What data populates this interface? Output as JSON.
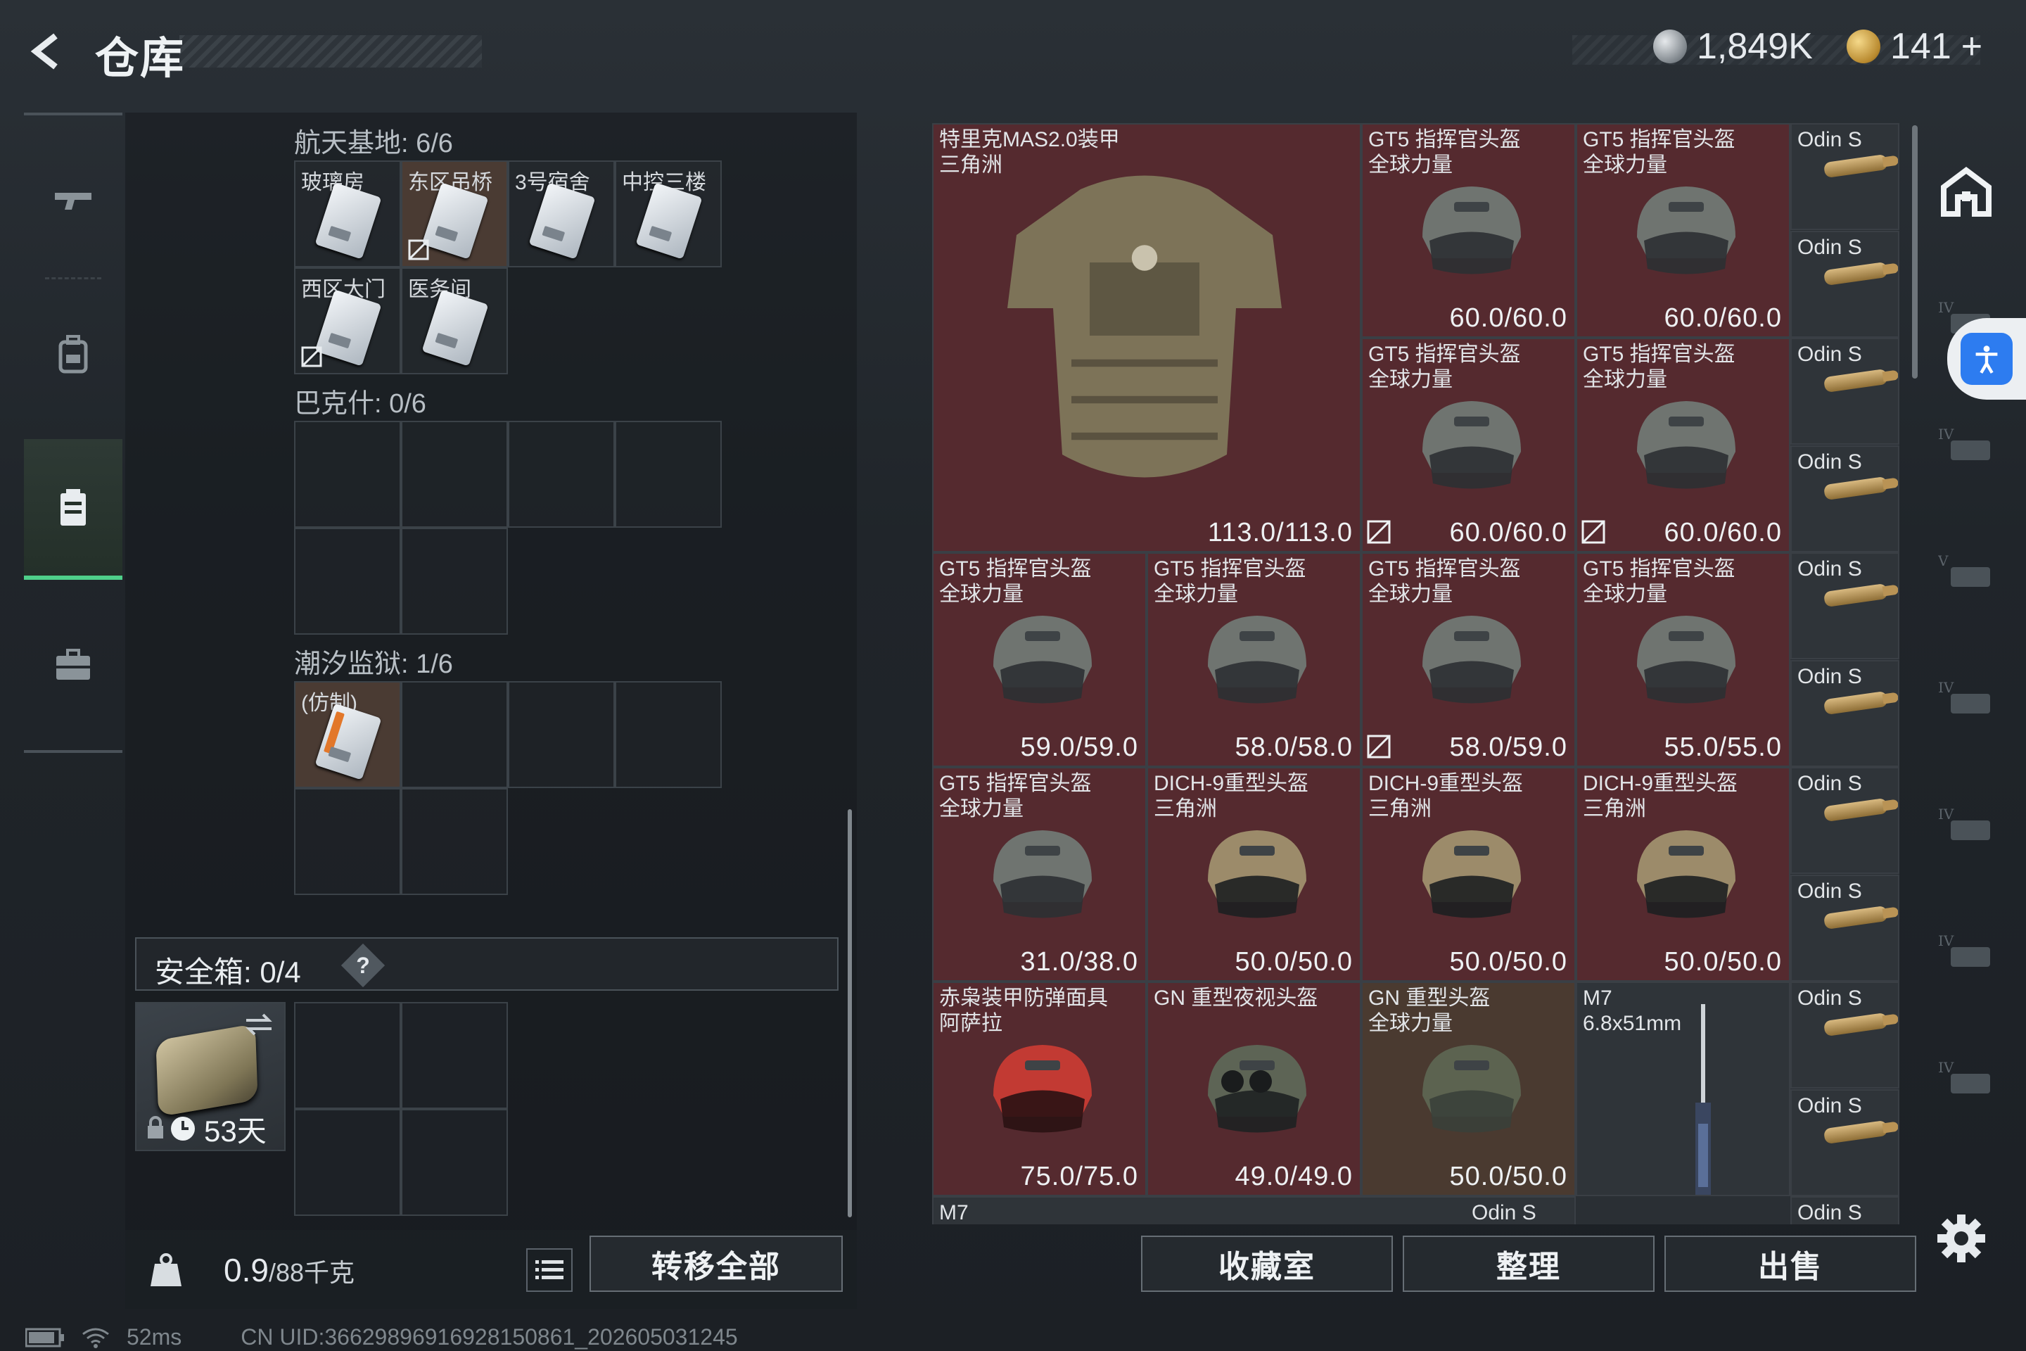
{
  "header": {
    "title": "仓库",
    "currency_silver": "1,849K",
    "currency_gold": "141",
    "plus": "+"
  },
  "containers": [
    {
      "label": "航天基地: 6/6",
      "keys": [
        "玻璃房",
        "东区吊桥",
        "3号宿舍",
        "中控三楼",
        "西区大门",
        "医务间"
      ]
    },
    {
      "label": "巴克什: 0/6",
      "keys": []
    },
    {
      "label": "潮汐监狱: 1/6",
      "keys": [
        "(仿制)"
      ]
    }
  ],
  "safebox": {
    "label": "安全箱:  0/4",
    "help": "?",
    "days": "53天"
  },
  "weight": {
    "current": "0.9",
    "max": "/88千克"
  },
  "buttons": {
    "transfer_all": "转移全部",
    "collection": "收藏室",
    "sort": "整理",
    "sell": "出售"
  },
  "stash_items": [
    {
      "name": "特里克MAS2.0装甲\n三角洲",
      "dur": "113.0/113.0",
      "kind": "armor"
    },
    {
      "name": "GT5 指挥官头盔\n全球力量",
      "dur": "60.0/60.0",
      "kind": "helmet"
    },
    {
      "name": "GT5 指挥官头盔\n全球力量",
      "dur": "60.0/60.0",
      "kind": "helmet"
    },
    {
      "name": "GT5 指挥官头盔\n全球力量",
      "dur": "60.0/60.0",
      "kind": "helmet"
    },
    {
      "name": "GT5 指挥官头盔\n全球力量",
      "dur": "60.0/60.0",
      "kind": "helmet"
    },
    {
      "name": "GT5 指挥官头盔\n全球力量",
      "dur": "59.0/59.0",
      "kind": "helmet"
    },
    {
      "name": "GT5 指挥官头盔\n全球力量",
      "dur": "58.0/58.0",
      "kind": "helmet"
    },
    {
      "name": "GT5 指挥官头盔\n全球力量",
      "dur": "58.0/59.0",
      "kind": "helmet"
    },
    {
      "name": "GT5 指挥官头盔\n全球力量",
      "dur": "55.0/55.0",
      "kind": "helmet"
    },
    {
      "name": "GT5 指挥官头盔\n全球力量",
      "dur": "31.0/38.0",
      "kind": "helmet"
    },
    {
      "name": "DICH-9重型头盔\n三角洲",
      "dur": "50.0/50.0",
      "kind": "dich"
    },
    {
      "name": "DICH-9重型头盔\n三角洲",
      "dur": "50.0/50.0",
      "kind": "dich"
    },
    {
      "name": "DICH-9重型头盔\n三角洲",
      "dur": "50.0/50.0",
      "kind": "dich"
    },
    {
      "name": "赤枭装甲防弹面具\n阿萨拉",
      "dur": "75.0/75.0",
      "kind": "mask"
    },
    {
      "name": "GN 重型夜视头盔",
      "dur": "49.0/49.0",
      "kind": "nv"
    },
    {
      "name": "GN 重型头盔\n全球力量",
      "dur": "50.0/50.0",
      "kind": "gn"
    },
    {
      "name": "M7\n6.8x51mm",
      "dur": "",
      "kind": "gun"
    },
    {
      "name": "M7",
      "dur": "",
      "kind": "partial"
    },
    {
      "name": "Odin S",
      "dur": "",
      "kind": "partial"
    }
  ],
  "ammo_label": "Odin S",
  "status": {
    "ping": "52ms",
    "uid": "CN UID:3662989691692815086​1_202605031245"
  },
  "colors": {
    "accent": "#4fd08a",
    "item_red": "#552a2f",
    "access_blue": "#2d7cf0"
  }
}
